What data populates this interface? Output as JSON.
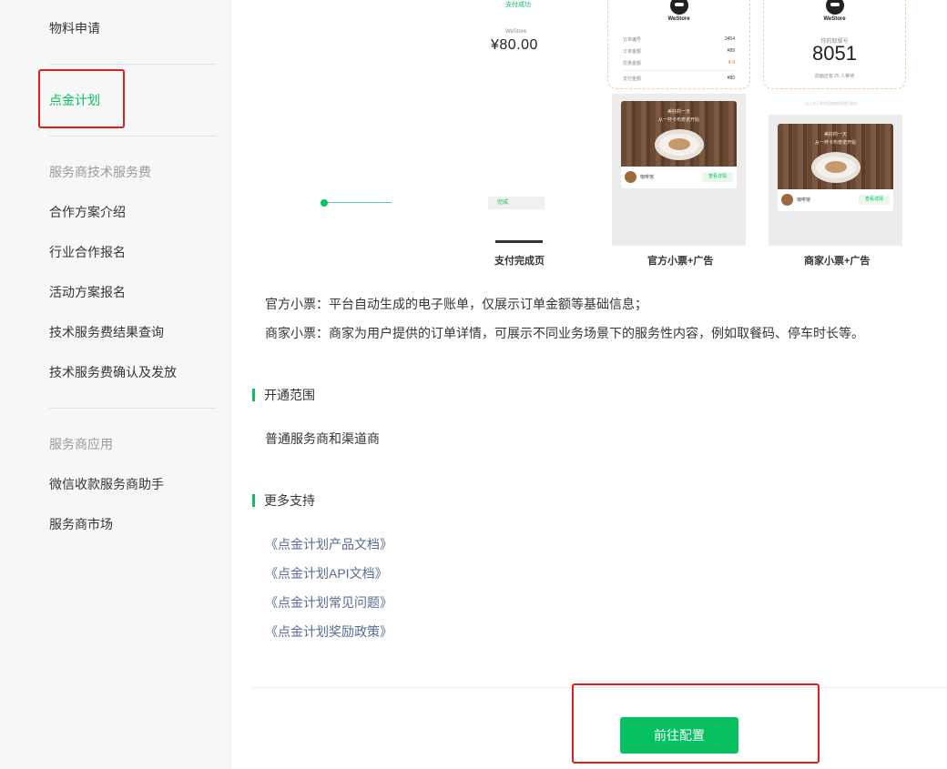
{
  "sidebar": {
    "items": [
      {
        "label": "物料申请"
      },
      {
        "label": "点金计划",
        "active": true
      }
    ],
    "group_tech_fee": {
      "title": "服务商技术服务费",
      "items": [
        "合作方案介绍",
        "行业合作报名",
        "活动方案报名",
        "技术服务费结果查询",
        "技术服务费确认及发放"
      ]
    },
    "group_apps": {
      "title": "服务商应用",
      "items": [
        "微信收款服务商助手",
        "服务商市场"
      ]
    }
  },
  "preview": {
    "pay_success_text": "支付成功",
    "store_name": "WeStore",
    "amount": "¥80.00",
    "done_label": "完成",
    "receipt": {
      "rows": [
        {
          "label": "订单编号",
          "value": "3454"
        },
        {
          "label": "订单金额",
          "value": "¥89"
        },
        {
          "label": "优惠金额",
          "value": "¥-9"
        },
        {
          "label": "支付金额",
          "value": "¥80"
        }
      ]
    },
    "queue": {
      "label": "你的取餐号",
      "number": "8051",
      "sub": "前面还有 25 人等待"
    },
    "faint_note": "以上为订单内容由商家提供 服务",
    "ad": {
      "photo_text_1": "美好的一天",
      "photo_text_2": "从一杯卡布奇诺开始",
      "shop_name": "咖啡馆",
      "button": "查看详情"
    },
    "captions": [
      "支付完成页",
      "官方小票+广告",
      "商家小票+广告"
    ]
  },
  "description": {
    "official": "官方小票：平台自动生成的电子账单，仅展示订单金额等基础信息；",
    "merchant": "商家小票：商家为用户提供的订单详情，可展示不同业务场景下的服务性内容，例如取餐码、停车时长等。"
  },
  "scope": {
    "title": "开通范围",
    "text": "普通服务商和渠道商"
  },
  "support": {
    "title": "更多支持",
    "links": [
      "《点金计划产品文档》",
      "《点金计划API文档》",
      "《点金计划常见问题》",
      "《点金计划奖励政策》"
    ]
  },
  "actions": {
    "configure_button": "前往配置"
  },
  "colors": {
    "accent": "#07c160",
    "link": "#576b95",
    "highlight_box": "#e0201c"
  }
}
